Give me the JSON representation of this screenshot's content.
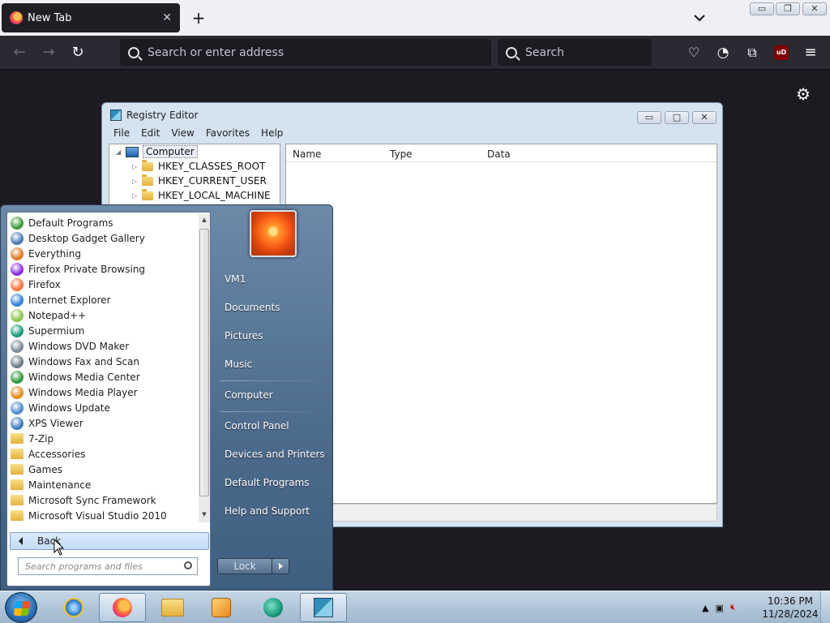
{
  "browser": {
    "tab_title": "New Tab",
    "urlbar_placeholder": "Search or enter address",
    "searchbar_placeholder": "Search",
    "ublock_label": "uD"
  },
  "regedit": {
    "title": "Registry Editor",
    "menu": [
      "File",
      "Edit",
      "View",
      "Favorites",
      "Help"
    ],
    "tree": {
      "root": "Computer",
      "keys": [
        "HKEY_CLASSES_ROOT",
        "HKEY_CURRENT_USER",
        "HKEY_LOCAL_MACHINE"
      ]
    },
    "columns": [
      "Name",
      "Type",
      "Data"
    ]
  },
  "startmenu": {
    "programs": [
      {
        "label": "Default Programs",
        "icon": "default-programs-icon",
        "color": "#3a9a3a"
      },
      {
        "label": "Desktop Gadget Gallery",
        "icon": "gadget-gallery-icon",
        "color": "#4a7ab8"
      },
      {
        "label": "Everything",
        "icon": "everything-icon",
        "color": "#e07820"
      },
      {
        "label": "Firefox Private Browsing",
        "icon": "firefox-private-icon",
        "color": "#8a2be2"
      },
      {
        "label": "Firefox",
        "icon": "firefox-icon",
        "color": "#ff7139"
      },
      {
        "label": "Internet Explorer",
        "icon": "internet-explorer-icon",
        "color": "#2f7fd8"
      },
      {
        "label": "Notepad++",
        "icon": "notepad-plus-plus-icon",
        "color": "#8ac34a"
      },
      {
        "label": "Supermium",
        "icon": "supermium-icon",
        "color": "#1a9a7a"
      },
      {
        "label": "Windows DVD Maker",
        "icon": "dvd-maker-icon",
        "color": "#7a8a9a"
      },
      {
        "label": "Windows Fax and Scan",
        "icon": "fax-scan-icon",
        "color": "#6a7a8a"
      },
      {
        "label": "Windows Media Center",
        "icon": "media-center-icon",
        "color": "#2a9a3a"
      },
      {
        "label": "Windows Media Player",
        "icon": "media-player-icon",
        "color": "#e88a1a"
      },
      {
        "label": "Windows Update",
        "icon": "windows-update-icon",
        "color": "#4a8ad0"
      },
      {
        "label": "XPS Viewer",
        "icon": "xps-viewer-icon",
        "color": "#3a7ac0"
      },
      {
        "label": "7-Zip",
        "icon": "folder-icon",
        "color": "#e5b13d"
      },
      {
        "label": "Accessories",
        "icon": "folder-icon",
        "color": "#e5b13d"
      },
      {
        "label": "Games",
        "icon": "folder-icon",
        "color": "#e5b13d"
      },
      {
        "label": "Maintenance",
        "icon": "folder-icon",
        "color": "#e5b13d"
      },
      {
        "label": "Microsoft Sync Framework",
        "icon": "folder-icon",
        "color": "#e5b13d"
      },
      {
        "label": "Microsoft Visual Studio 2010",
        "icon": "folder-icon",
        "color": "#e5b13d"
      }
    ],
    "back_label": "Back",
    "search_placeholder": "Search programs and files",
    "right_links": [
      "VM1",
      "Documents",
      "Pictures",
      "Music",
      "Computer",
      "Control Panel",
      "Devices and Printers",
      "Default Programs",
      "Help and Support"
    ],
    "lock_label": "Lock"
  },
  "taskbar": {
    "clock_time": "10:36 PM",
    "clock_date": "11/28/2024"
  }
}
